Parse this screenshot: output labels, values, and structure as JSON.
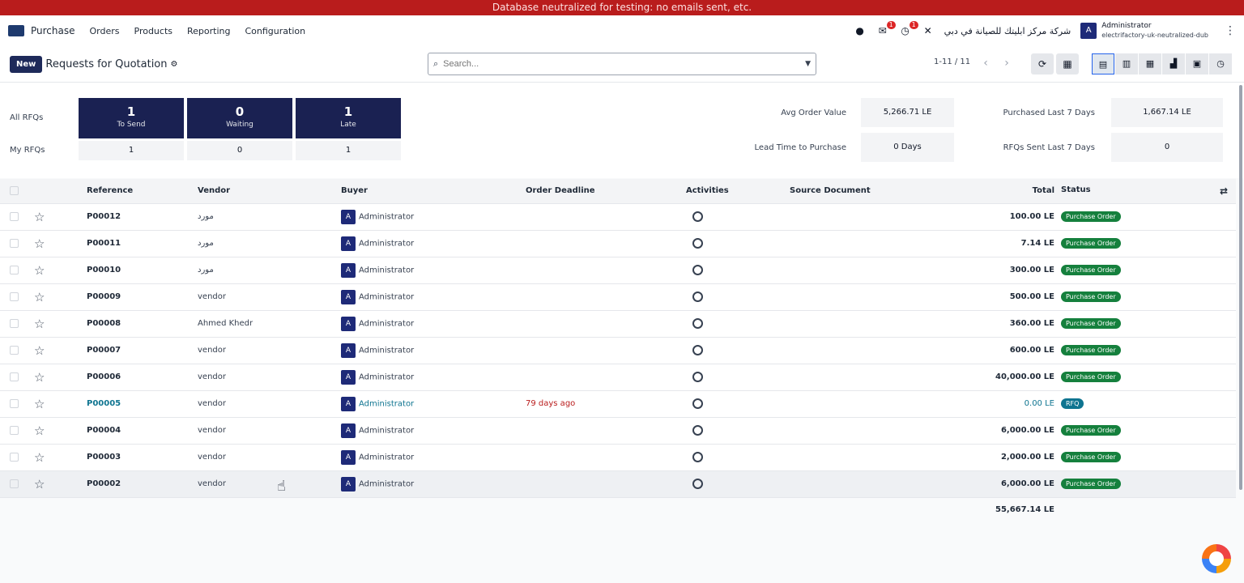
{
  "banner": "Database neutralized for testing: no emails sent, etc.",
  "navbar": {
    "app_name": "Purchase",
    "menu": [
      "Orders",
      "Products",
      "Reporting",
      "Configuration"
    ],
    "chat_badge": "1",
    "activity_badge": "1",
    "company": "شركة مركز ابليتك للصيانة في دبي",
    "user_initial": "A",
    "user_name": "Administrator",
    "user_db": "electrifactory-uk-neutralized-dub"
  },
  "control_panel": {
    "new_label": "New",
    "title": "Requests for Quotation",
    "search_placeholder": "Search...",
    "pager": "1-11 / 11"
  },
  "dashboard": {
    "all_rfqs_label": "All RFQs",
    "my_rfqs_label": "My RFQs",
    "cards": [
      {
        "num": "1",
        "label": "To Send",
        "mine": "1"
      },
      {
        "num": "0",
        "label": "Waiting",
        "mine": "0"
      },
      {
        "num": "1",
        "label": "Late",
        "mine": "1"
      }
    ],
    "kpis": [
      {
        "label": "Avg Order Value",
        "value": "5,266.71 LE"
      },
      {
        "label": "Purchased Last 7 Days",
        "value": "1,667.14 LE"
      },
      {
        "label": "Lead Time to Purchase",
        "value": "0 Days"
      },
      {
        "label": "RFQs Sent Last 7 Days",
        "value": "0"
      }
    ]
  },
  "table": {
    "headers": {
      "reference": "Reference",
      "vendor": "Vendor",
      "buyer": "Buyer",
      "deadline": "Order Deadline",
      "activities": "Activities",
      "source": "Source Document",
      "total": "Total",
      "status": "Status"
    },
    "rows": [
      {
        "ref": "P00012",
        "vendor": "مورد",
        "buyer": "Administrator",
        "deadline": "",
        "total": "100.00 LE",
        "status": "Purchase Order"
      },
      {
        "ref": "P00011",
        "vendor": "مورد",
        "buyer": "Administrator",
        "deadline": "",
        "total": "7.14 LE",
        "status": "Purchase Order"
      },
      {
        "ref": "P00010",
        "vendor": "مورد",
        "buyer": "Administrator",
        "deadline": "",
        "total": "300.00 LE",
        "status": "Purchase Order"
      },
      {
        "ref": "P00009",
        "vendor": "vendor",
        "buyer": "Administrator",
        "deadline": "",
        "total": "500.00 LE",
        "status": "Purchase Order"
      },
      {
        "ref": "P00008",
        "vendor": "Ahmed Khedr",
        "buyer": "Administrator",
        "deadline": "",
        "total": "360.00 LE",
        "status": "Purchase Order"
      },
      {
        "ref": "P00007",
        "vendor": "vendor",
        "buyer": "Administrator",
        "deadline": "",
        "total": "600.00 LE",
        "status": "Purchase Order"
      },
      {
        "ref": "P00006",
        "vendor": "vendor",
        "buyer": "Administrator",
        "deadline": "",
        "total": "40,000.00 LE",
        "status": "Purchase Order"
      },
      {
        "ref": "P00005",
        "vendor": "vendor",
        "buyer": "Administrator",
        "deadline": "79 days ago",
        "total": "0.00 LE",
        "status": "RFQ"
      },
      {
        "ref": "P00004",
        "vendor": "vendor",
        "buyer": "Administrator",
        "deadline": "",
        "total": "6,000.00 LE",
        "status": "Purchase Order"
      },
      {
        "ref": "P00003",
        "vendor": "vendor",
        "buyer": "Administrator",
        "deadline": "",
        "total": "2,000.00 LE",
        "status": "Purchase Order"
      },
      {
        "ref": "P00002",
        "vendor": "vendor",
        "buyer": "Administrator",
        "deadline": "",
        "total": "6,000.00 LE",
        "status": "Purchase Order"
      }
    ],
    "grand_total": "55,667.14 LE"
  },
  "colors": {
    "banner": "#b91c1c",
    "primary": "#1a2152",
    "status_green": "#15803d",
    "link": "#0e7490"
  }
}
